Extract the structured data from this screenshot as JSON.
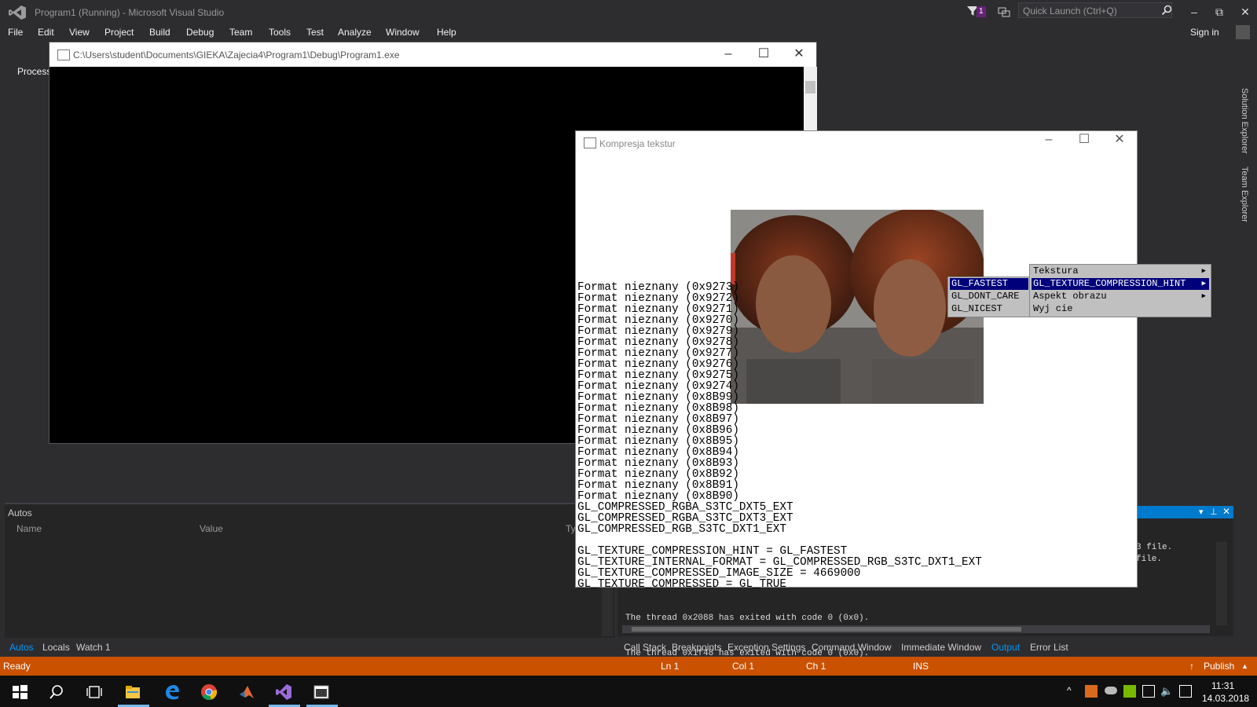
{
  "vs": {
    "title": "Program1 (Running) - Microsoft Visual Studio",
    "notification_count": "1",
    "quick_launch_placeholder": "Quick Launch (Ctrl+Q)",
    "menu": [
      "File",
      "Edit",
      "View",
      "Project",
      "Build",
      "Debug",
      "Team",
      "Tools",
      "Test",
      "Analyze",
      "Window",
      "Help"
    ],
    "sign_in": "Sign in",
    "process_label": "Process",
    "right_rail": [
      "Solution Explorer",
      "Team Explorer"
    ]
  },
  "console": {
    "title": "C:\\Users\\student\\Documents\\GIEKA\\Zajecia4\\Program1\\Debug\\Program1.exe"
  },
  "gl_window": {
    "title": "Kompresja tekstur",
    "lines": [
      "Format nieznany (0x9273)",
      "Format nieznany (0x9272)",
      "Format nieznany (0x9271)",
      "Format nieznany (0x9270)",
      "Format nieznany (0x9279)",
      "Format nieznany (0x9278)",
      "Format nieznany (0x9277)",
      "Format nieznany (0x9276)",
      "Format nieznany (0x9275)",
      "Format nieznany (0x9274)",
      "Format nieznany (0x8B99)",
      "Format nieznany (0x8B98)",
      "Format nieznany (0x8B97)",
      "Format nieznany (0x8B96)",
      "Format nieznany (0x8B95)",
      "Format nieznany (0x8B94)",
      "Format nieznany (0x8B93)",
      "Format nieznany (0x8B92)",
      "Format nieznany (0x8B91)",
      "Format nieznany (0x8B90)",
      "GL_COMPRESSED_RGBA_S3TC_DXT5_EXT",
      "GL_COMPRESSED_RGBA_S3TC_DXT3_EXT",
      "GL_COMPRESSED_RGB_S3TC_DXT1_EXT",
      "",
      "GL_TEXTURE_COMPRESSION_HINT = GL_FASTEST",
      "GL_TEXTURE_INTERNAL_FORMAT = GL_COMPRESSED_RGB_S3TC_DXT1_EXT",
      "GL_TEXTURE_COMPRESSED_IMAGE_SIZE = 4669000",
      "GL_TEXTURE_COMPRESSED = GL_TRUE"
    ]
  },
  "context_menu": {
    "main": [
      {
        "label": "Tekstura",
        "arrow": true,
        "selected": false
      },
      {
        "label": "GL_TEXTURE_COMPRESSION_HINT",
        "arrow": true,
        "selected": true
      },
      {
        "label": "Aspekt obrazu",
        "arrow": true,
        "selected": false
      },
      {
        "label": "Wyj cie",
        "arrow": false,
        "selected": false
      }
    ],
    "sub": [
      {
        "label": "GL_FASTEST",
        "selected": true
      },
      {
        "label": "GL_DONT_CARE",
        "selected": false
      },
      {
        "label": "GL_NICEST",
        "selected": false
      }
    ]
  },
  "autos": {
    "title": "Autos",
    "col_name": "Name",
    "col_value": "Value",
    "col_type": "Ty"
  },
  "output": {
    "partial_right": [
      "3 file.",
      "file."
    ],
    "lines": [
      "The thread 0x2088 has exited with code 0 (0x0).",
      "The thread 0x1f48 has exited with code 0 (0x0)."
    ]
  },
  "bottom_tabs_left": [
    {
      "label": "Autos",
      "active": true
    },
    {
      "label": "Locals",
      "active": false
    },
    {
      "label": "Watch 1",
      "active": false
    }
  ],
  "bottom_tabs_right": [
    {
      "label": "Call Stack",
      "active": false
    },
    {
      "label": "Breakpoints",
      "active": false
    },
    {
      "label": "Exception Settings",
      "active": false
    },
    {
      "label": "Command Window",
      "active": false
    },
    {
      "label": "Immediate Window",
      "active": false
    },
    {
      "label": "Output",
      "active": true
    },
    {
      "label": "Error List",
      "active": false
    }
  ],
  "status": {
    "ready": "Ready",
    "ln": "Ln 1",
    "col": "Col 1",
    "ch": "Ch 1",
    "ins": "INS",
    "publish": "Publish"
  },
  "taskbar": {
    "time": "11:31",
    "date": "14.03.2018"
  },
  "colors": {
    "accent": "#007acc",
    "status_bar": "#ca5100",
    "menu_selected": "#00007b"
  }
}
